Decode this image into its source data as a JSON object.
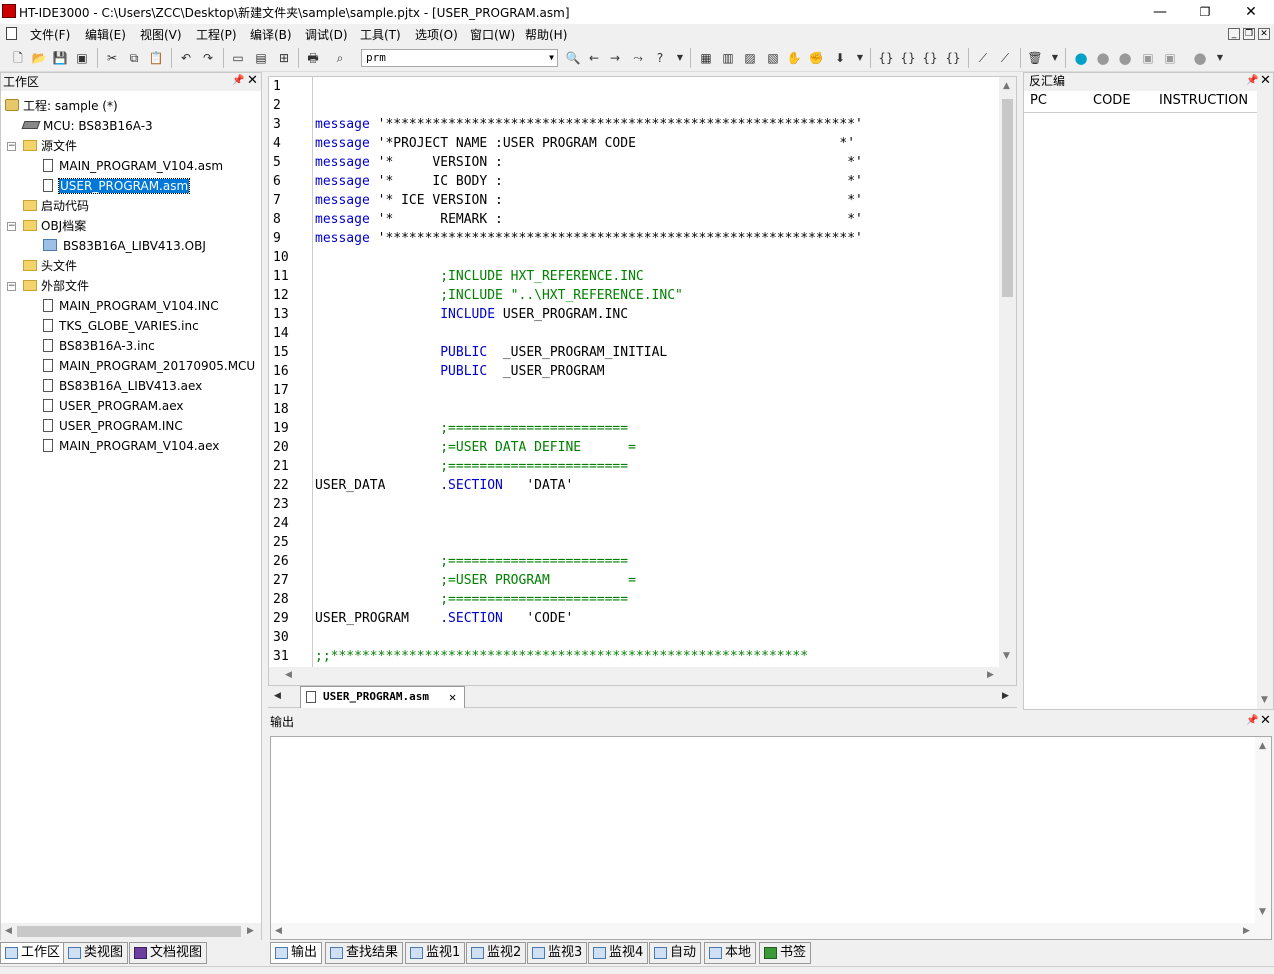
{
  "window": {
    "title": "HT-IDE3000 - C:\\Users\\ZCC\\Desktop\\新建文件夹\\sample\\sample.pjtx - [USER_PROGRAM.asm]",
    "minimize": "—",
    "restore": "❐",
    "close": "✕"
  },
  "menu": [
    "文件(F)",
    "编辑(E)",
    "视图(V)",
    "工程(P)",
    "编译(B)",
    "调试(D)",
    "工具(T)",
    "选项(O)",
    "窗口(W)",
    "帮助(H)"
  ],
  "toolbar": {
    "combo_value": "prm"
  },
  "workspace": {
    "title": "工作区",
    "project": "工程: sample (*)",
    "mcu": "MCU: BS83B16A-3",
    "folders": {
      "source": "源文件",
      "startup": "启动代码",
      "obj": "OBJ档案",
      "header": "头文件",
      "external": "外部文件"
    },
    "source_files": [
      "MAIN_PROGRAM_V104.asm",
      "USER_PROGRAM.asm"
    ],
    "obj_files": [
      "BS83B16A_LIBV413.OBJ"
    ],
    "external_files": [
      "MAIN_PROGRAM_V104.INC",
      "TKS_GLOBE_VARIES.inc",
      "BS83B16A-3.inc",
      "MAIN_PROGRAM_20170905.MCU",
      "BS83B16A_LIBV413.aex",
      "USER_PROGRAM.aex",
      "USER_PROGRAM.INC",
      "MAIN_PROGRAM_V104.aex"
    ]
  },
  "editor": {
    "tab_label": "USER_PROGRAM.asm",
    "lines": [
      {
        "n": "1",
        "parts": []
      },
      {
        "n": "2",
        "parts": []
      },
      {
        "n": "3",
        "parts": [
          {
            "t": "message",
            "c": "kw"
          },
          {
            "t": " '************************************************************'",
            "c": ""
          }
        ]
      },
      {
        "n": "4",
        "parts": [
          {
            "t": "message",
            "c": "kw"
          },
          {
            "t": " '*PROJECT NAME :USER PROGRAM CODE                          *'",
            "c": ""
          }
        ]
      },
      {
        "n": "5",
        "parts": [
          {
            "t": "message",
            "c": "kw"
          },
          {
            "t": " '*     VERSION :                                            *'",
            "c": ""
          }
        ]
      },
      {
        "n": "6",
        "parts": [
          {
            "t": "message",
            "c": "kw"
          },
          {
            "t": " '*     IC BODY :                                            *'",
            "c": ""
          }
        ]
      },
      {
        "n": "7",
        "parts": [
          {
            "t": "message",
            "c": "kw"
          },
          {
            "t": " '* ICE VERSION :                                            *'",
            "c": ""
          }
        ]
      },
      {
        "n": "8",
        "parts": [
          {
            "t": "message",
            "c": "kw"
          },
          {
            "t": " '*      REMARK :                                            *'",
            "c": ""
          }
        ]
      },
      {
        "n": "9",
        "parts": [
          {
            "t": "message",
            "c": "kw"
          },
          {
            "t": " '************************************************************'",
            "c": ""
          }
        ]
      },
      {
        "n": "10",
        "parts": []
      },
      {
        "n": "11",
        "parts": [
          {
            "t": "                ",
            "c": ""
          },
          {
            "t": ";INCLUDE HXT_REFERENCE.INC",
            "c": "cm"
          }
        ]
      },
      {
        "n": "12",
        "parts": [
          {
            "t": "                ",
            "c": ""
          },
          {
            "t": ";INCLUDE \"..\\HXT_REFERENCE.INC\"",
            "c": "cm"
          }
        ]
      },
      {
        "n": "13",
        "parts": [
          {
            "t": "                ",
            "c": ""
          },
          {
            "t": "INCLUDE",
            "c": "kw"
          },
          {
            "t": " USER_PROGRAM.INC",
            "c": ""
          }
        ]
      },
      {
        "n": "14",
        "parts": []
      },
      {
        "n": "15",
        "parts": [
          {
            "t": "                ",
            "c": ""
          },
          {
            "t": "PUBLIC",
            "c": "kw"
          },
          {
            "t": "  _USER_PROGRAM_INITIAL",
            "c": ""
          }
        ]
      },
      {
        "n": "16",
        "parts": [
          {
            "t": "                ",
            "c": ""
          },
          {
            "t": "PUBLIC",
            "c": "kw"
          },
          {
            "t": "  _USER_PROGRAM",
            "c": ""
          }
        ]
      },
      {
        "n": "17",
        "parts": []
      },
      {
        "n": "18",
        "parts": []
      },
      {
        "n": "19",
        "parts": [
          {
            "t": "                ",
            "c": ""
          },
          {
            "t": ";=======================",
            "c": "cm"
          }
        ]
      },
      {
        "n": "20",
        "parts": [
          {
            "t": "                ",
            "c": ""
          },
          {
            "t": ";=USER DATA DEFINE      =",
            "c": "cm"
          }
        ]
      },
      {
        "n": "21",
        "parts": [
          {
            "t": "                ",
            "c": ""
          },
          {
            "t": ";=======================",
            "c": "cm"
          }
        ]
      },
      {
        "n": "22",
        "parts": [
          {
            "t": "USER_DATA       ",
            "c": ""
          },
          {
            "t": ".SECTION",
            "c": "kw"
          },
          {
            "t": "   'DATA'",
            "c": ""
          }
        ]
      },
      {
        "n": "23",
        "parts": []
      },
      {
        "n": "24",
        "parts": []
      },
      {
        "n": "25",
        "parts": []
      },
      {
        "n": "26",
        "parts": [
          {
            "t": "                ",
            "c": ""
          },
          {
            "t": ";=======================",
            "c": "cm"
          }
        ]
      },
      {
        "n": "27",
        "parts": [
          {
            "t": "                ",
            "c": ""
          },
          {
            "t": ";=USER PROGRAM          =",
            "c": "cm"
          }
        ]
      },
      {
        "n": "28",
        "parts": [
          {
            "t": "                ",
            "c": ""
          },
          {
            "t": ";=======================",
            "c": "cm"
          }
        ]
      },
      {
        "n": "29",
        "parts": [
          {
            "t": "USER_PROGRAM    ",
            "c": ""
          },
          {
            "t": ".SECTION",
            "c": "kw"
          },
          {
            "t": "   'CODE'",
            "c": ""
          }
        ]
      },
      {
        "n": "30",
        "parts": []
      },
      {
        "n": "31",
        "parts": [
          {
            "t": ";;*************************************************************",
            "c": "cm"
          }
        ]
      }
    ]
  },
  "disasm": {
    "title": "反汇编",
    "columns": [
      "PC",
      "CODE",
      "INSTRUCTION"
    ]
  },
  "output": {
    "title": "输出"
  },
  "workspace_tabs": [
    "工作区",
    "类视图",
    "文档视图"
  ],
  "output_tabs": [
    "输出",
    "查找结果",
    "监视1",
    "监视2",
    "监视3",
    "监视4",
    "自动",
    "本地",
    "书签"
  ]
}
